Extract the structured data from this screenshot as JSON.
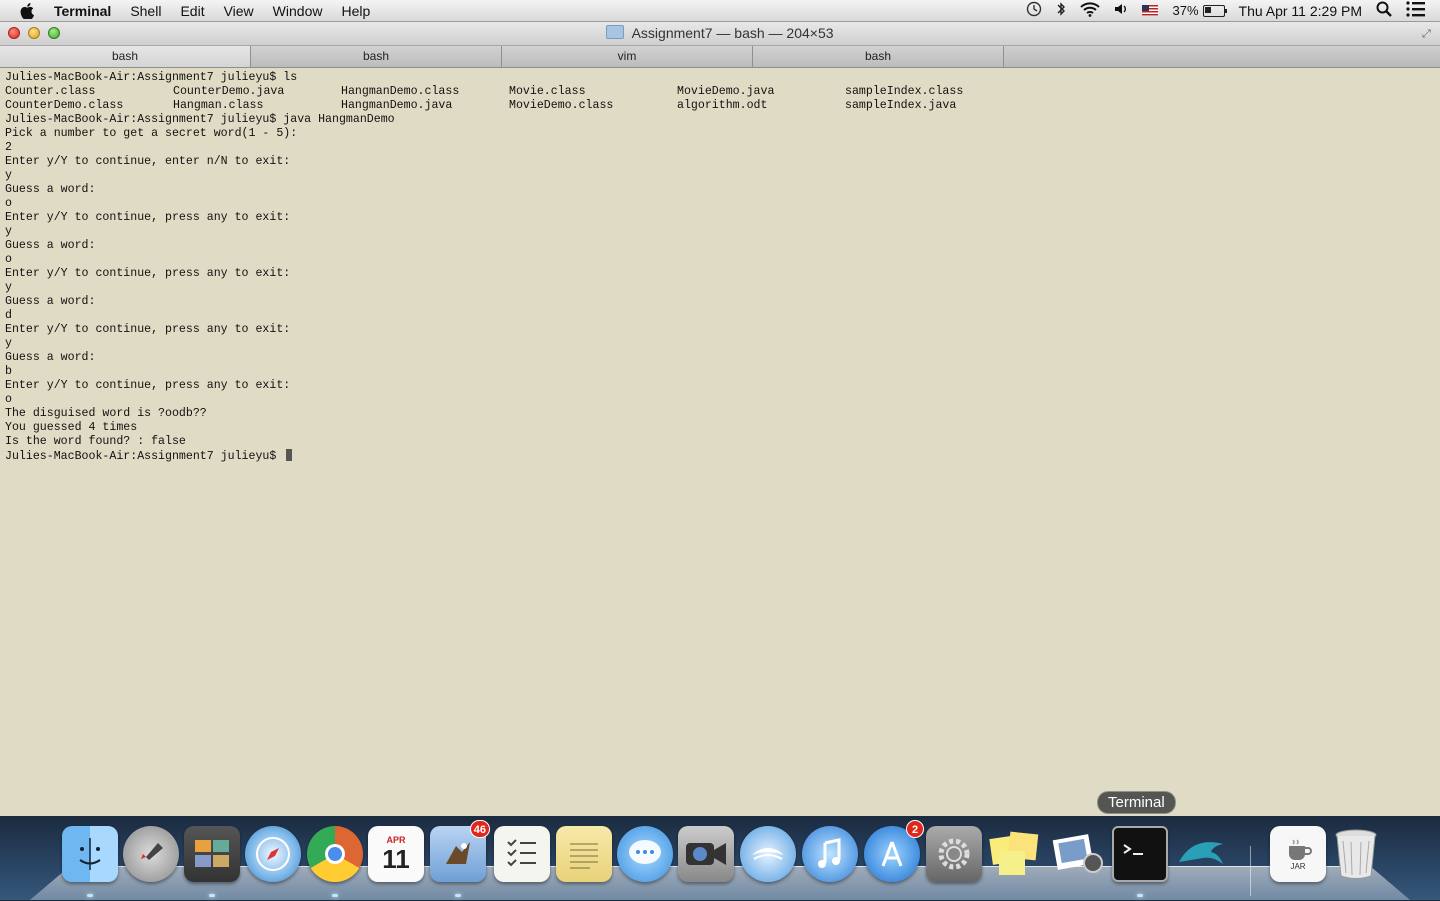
{
  "menubar": {
    "app_name": "Terminal",
    "items": [
      "Shell",
      "Edit",
      "View",
      "Window",
      "Help"
    ],
    "battery_percent": "37%",
    "datetime": "Thu Apr 11  2:29 PM"
  },
  "window": {
    "title": "Assignment7 — bash — 204×53",
    "tabs": [
      {
        "label": "bash"
      },
      {
        "label": "bash"
      },
      {
        "label": "vim"
      },
      {
        "label": "bash"
      }
    ]
  },
  "terminal": {
    "prompt_ls": "Julies-MacBook-Air:Assignment7 julieyu$ ls",
    "ls_rows": [
      [
        "Counter.class",
        "CounterDemo.java",
        "HangmanDemo.class",
        "Movie.class",
        "MovieDemo.java",
        "sampleIndex.class"
      ],
      [
        "CounterDemo.class",
        "Hangman.class",
        "HangmanDemo.java",
        "MovieDemo.class",
        "algorithm.odt",
        "sampleIndex.java"
      ]
    ],
    "lines": [
      "Julies-MacBook-Air:Assignment7 julieyu$ java HangmanDemo",
      "Pick a number to get a secret word(1 - 5):",
      "2",
      "Enter y/Y to continue, enter n/N to exit:",
      "y",
      "Guess a word:",
      "o",
      "Enter y/Y to continue, press any to exit:",
      "y",
      "Guess a word:",
      "o",
      "Enter y/Y to continue, press any to exit:",
      "y",
      "Guess a word:",
      "d",
      "Enter y/Y to continue, press any to exit:",
      "y",
      "Guess a word:",
      "b",
      "Enter y/Y to continue, press any to exit:",
      "o",
      "The disguised word is ?oodb??",
      "You guessed 4 times",
      "Is the word found? : false"
    ],
    "final_prompt": "Julies-MacBook-Air:Assignment7 julieyu$ "
  },
  "dock": {
    "tooltip": "Terminal",
    "mail_badge": "46",
    "appstore_badge": "2",
    "calendar_month": "APR",
    "calendar_day": "11",
    "jar_label": "JAR"
  }
}
